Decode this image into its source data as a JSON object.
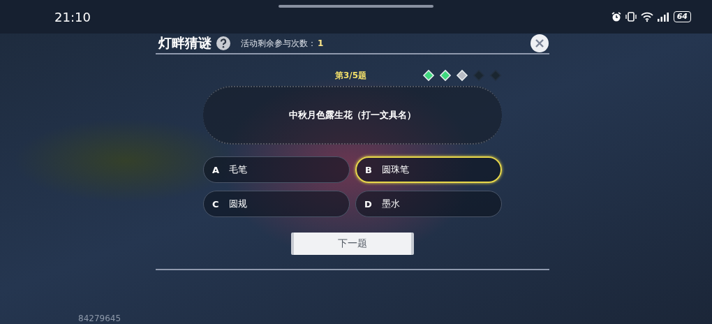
{
  "status_bar": {
    "time": "21:10",
    "battery": "64"
  },
  "header": {
    "title": "灯畔猜谜",
    "remaining_label": "活动剩余参与次数：",
    "remaining_value": "1"
  },
  "progress": {
    "label": "第3/5题",
    "steps": [
      {
        "kind": "done"
      },
      {
        "kind": "done"
      },
      {
        "kind": "current"
      },
      {
        "kind": "pending"
      },
      {
        "kind": "pending"
      }
    ]
  },
  "question": "中秋月色露生花（打一文具名）",
  "options": [
    {
      "letter": "A",
      "text": "毛笔",
      "selected": false
    },
    {
      "letter": "B",
      "text": "圆珠笔",
      "selected": true
    },
    {
      "letter": "C",
      "text": "圆规",
      "selected": false
    },
    {
      "letter": "D",
      "text": "墨水",
      "selected": false
    }
  ],
  "next_button": "下一题",
  "user_id": "84279645"
}
